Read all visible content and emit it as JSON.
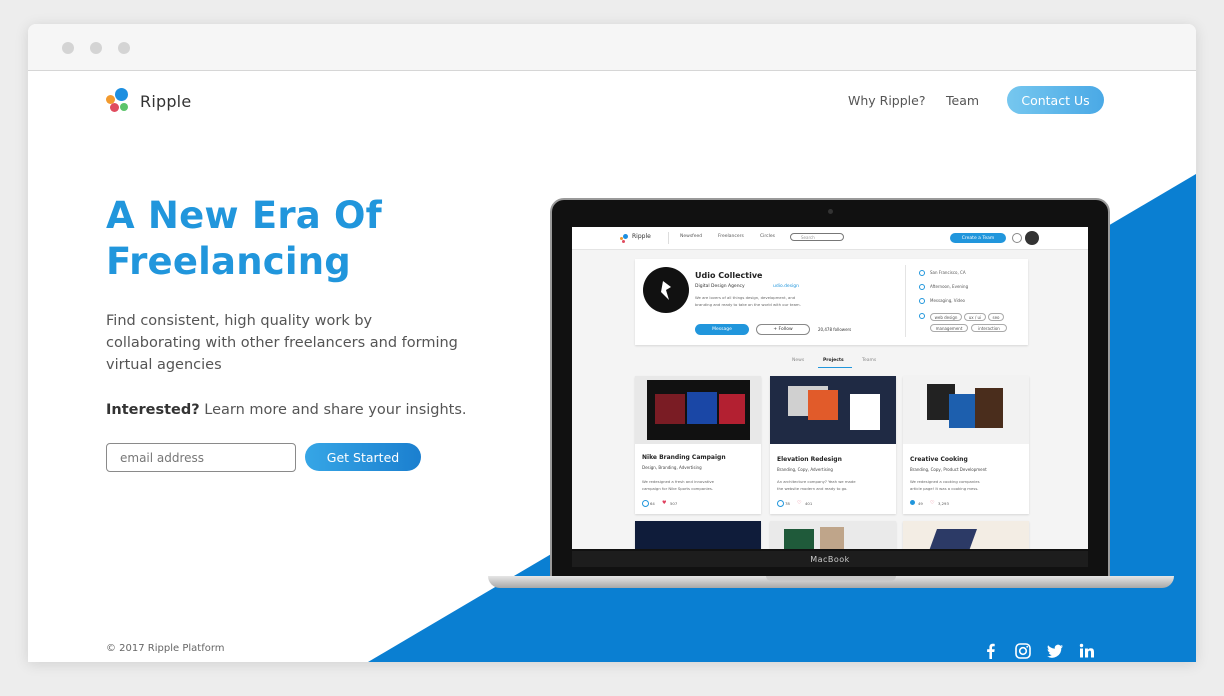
{
  "brand": {
    "name": "Ripple"
  },
  "nav": {
    "why": "Why Ripple?",
    "team": "Team",
    "contact": "Contact Us"
  },
  "hero": {
    "title_line1": "A New Era Of",
    "title_line2": "Freelancing",
    "subtitle": "Find consistent, high quality work by collaborating with other freelancers and forming virtual agencies",
    "interested_bold": "Interested?",
    "interested_rest": " Learn more and share your insights.",
    "email_placeholder": "email address",
    "cta": "Get Started"
  },
  "footer": {
    "copyright": "© 2017 Ripple Platform",
    "social": [
      "facebook-icon",
      "instagram-icon",
      "twitter-icon",
      "linkedin-icon"
    ]
  },
  "colors": {
    "accent": "#2196dc",
    "blue_bg": "#0a7fd2",
    "contact": "#5bb6ec"
  },
  "laptop": {
    "label": "MacBook",
    "app": {
      "brand": "Ripple",
      "nav": [
        "Newsfeed",
        "Freelancers",
        "Circles"
      ],
      "search_placeholder": "Search",
      "create_team": "Create a Team",
      "profile": {
        "name": "Udio Collective",
        "type": "Digital Design Agency",
        "site": "udio.design",
        "bio_line1": "We are lovers of all things design, development, and",
        "bio_line2": "branding and ready to take on the world with our team.",
        "message_btn": "Message",
        "follow_btn": "+ Follow",
        "followers": "20,478 followers",
        "location": "San Francisco, CA",
        "availability": "Afternoon, Evening",
        "contact_pref": "Messaging, Video",
        "tags": [
          "web design",
          "ux / ui",
          "seo",
          "management",
          "interaction"
        ]
      },
      "tabs": [
        "News",
        "Projects",
        "Teams"
      ],
      "projects": [
        {
          "title": "Nike Branding Campaign",
          "tags": "Design, Branding, Advertising",
          "desc1": "We redesigned a fresh and innovative",
          "desc2": "campaign for Nike Sports companies.",
          "comments": "64",
          "likes": "507"
        },
        {
          "title": "Elevation Redesign",
          "tags": "Branding, Copy, Advertising",
          "desc1": "An architecture company? Yeah we made",
          "desc2": "the website modern and ready to go.",
          "comments": "78",
          "likes": "401"
        },
        {
          "title": "Creative Cooking",
          "tags": "Branding, Copy, Product Development",
          "desc1": "We redesigned a cooking companies",
          "desc2": "article page! It was a cooking mess.",
          "comments": "49",
          "likes": "3,293"
        }
      ]
    }
  }
}
